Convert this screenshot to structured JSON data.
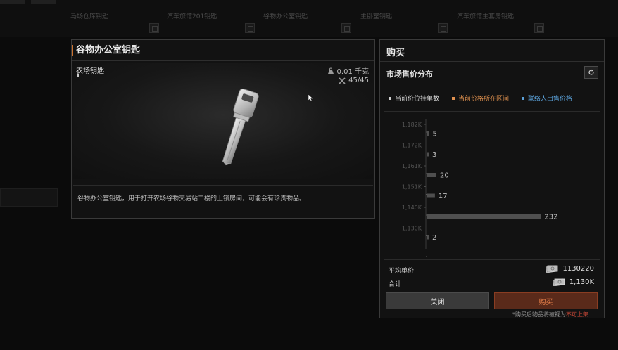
{
  "background": {
    "items": [
      "马场仓库钥匙",
      "汽车旅馆201钥匙",
      "谷物办公室钥匙",
      "主卧室钥匙",
      "汽车旅馆主套房钥匙"
    ]
  },
  "item": {
    "title": "谷物办公室钥匙",
    "type": "农场钥匙",
    "weight": "0.01 千克",
    "durability": "45/45",
    "description": "谷物办公室钥匙，用于打开农场谷物交易站二楼的上锁房间，可能会有珍贵物品。"
  },
  "buy": {
    "title": "购买",
    "distribution_title": "市场售价分布",
    "legend": [
      {
        "label": "当前价位挂单数",
        "color": "#cfcfcf"
      },
      {
        "label": "当前价格所在区间",
        "color": "#e0914f"
      },
      {
        "label": "联络人出售价格",
        "color": "#5aa0d8"
      }
    ],
    "avg_label": "平均单价",
    "avg_value": "1130220",
    "total_label": "合计",
    "total_value": "1,130K",
    "close_label": "关闭",
    "buy_label": "购买",
    "footnote_prefix": "*购买后物品将被视为",
    "footnote_highlight": "不可上架"
  },
  "chart_data": {
    "type": "bar",
    "orientation": "horizontal",
    "categories": [
      "1,182K",
      "1,172K",
      "1,161K",
      "1,151K",
      "1,140K",
      "1,130K"
    ],
    "tick_labels": [
      "1,182K",
      "1,172K",
      "1,161K",
      "1,151K",
      "1,140K",
      "1,130K"
    ],
    "values": [
      5,
      3,
      20,
      17,
      232,
      2
    ],
    "value_labels": [
      "5",
      "3",
      "20",
      "17",
      "232",
      "2"
    ],
    "xlim": [
      0,
      240
    ],
    "grid": false
  }
}
